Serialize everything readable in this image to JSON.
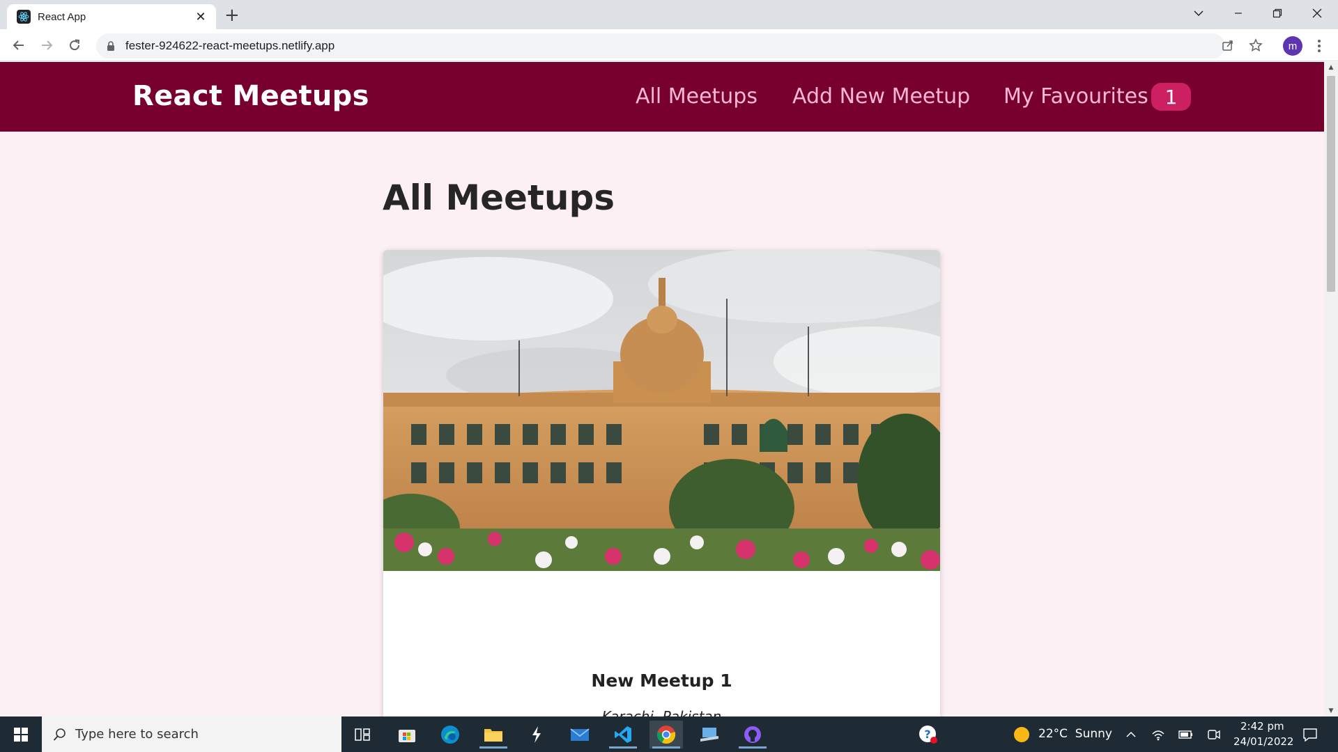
{
  "browser": {
    "tab_title": "React App",
    "tab_close": "✕",
    "new_tab": "+",
    "url": "fester-924622-react-meetups.netlify.app",
    "profile_initial": "m"
  },
  "header": {
    "logo": "React Meetups",
    "nav": {
      "all_meetups": "All Meetups",
      "add_new_meetup": "Add New Meetup",
      "my_favourites": "My Favourites",
      "favourites_count": "1"
    }
  },
  "main": {
    "title": "All Meetups",
    "meetups": [
      {
        "title": "New Meetup 1",
        "address": "Karachi, Pakistan",
        "description": "........."
      }
    ]
  },
  "taskbar": {
    "search_placeholder": "Type here to search",
    "weather": "22°C  Sunny",
    "time": "2:42 pm",
    "date": "24/01/2022"
  },
  "colors": {
    "header_bg": "#77002e",
    "nav_text": "#fcb8d2",
    "badge_bg": "#cc2062",
    "page_bg": "#fcf0f4"
  }
}
